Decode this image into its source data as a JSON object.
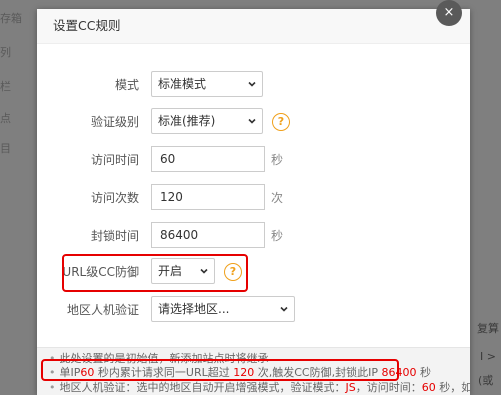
{
  "background": {
    "left_fragments": [
      "存箱",
      "列",
      "栏",
      "点",
      "目"
    ],
    "right_fragments": [
      "复算",
      "I >",
      "(或"
    ]
  },
  "dialog": {
    "title": "设置CC规则",
    "close_icon": "×"
  },
  "form": {
    "mode": {
      "label": "模式",
      "value": "标准模式"
    },
    "verify_level": {
      "label": "验证级别",
      "value": "标准(推荐)"
    },
    "visit_time": {
      "label": "访问时间",
      "value": "60",
      "unit": "秒"
    },
    "visit_count": {
      "label": "访问次数",
      "value": "120",
      "unit": "次"
    },
    "block_time": {
      "label": "封锁时间",
      "value": "86400",
      "unit": "秒"
    },
    "url_cc": {
      "label": "URL级CC防御",
      "value": "开启"
    },
    "region_verify": {
      "label": "地区人机验证",
      "value": "请选择地区..."
    }
  },
  "notes": {
    "line1": "此处设置的是初始值，新添加站点时将继承",
    "line2": {
      "p1": "单IP",
      "v1": "60",
      "p2": " 秒内累计请求同一URL超过 ",
      "v2": "120",
      "p3": " 次,触发CC防御,封锁此IP ",
      "v3": "86400",
      "p4": " 秒"
    },
    "line3": {
      "p1": "地区人机验证：选中的地区自动开启增强模式，验证模式：",
      "v1": "JS",
      "p2": "，访问时间：",
      "v2": "60",
      "p3": " 秒，如验证"
    }
  },
  "colors": {
    "highlight": "#e60000",
    "help_icon": "#f0a01b"
  }
}
